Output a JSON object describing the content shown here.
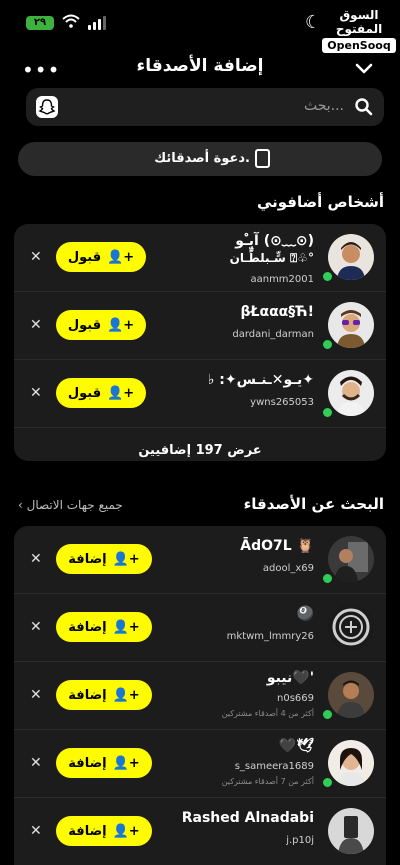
{
  "status": {
    "battery": "٢٩"
  },
  "brand": {
    "ar": "السوق المفتوح",
    "en": "OpenSooq"
  },
  "header": {
    "title": "إضافة الأصدقاء",
    "more": "•••"
  },
  "search": {
    "placeholder": "بحث..."
  },
  "invite": {
    "label": "دعوة أصدقائك."
  },
  "added_me": {
    "title": "أشخاص أضافوني",
    "view_all": "عرض 197 إضافيين",
    "accept_label": "قبول",
    "items": [
      {
        "name_line1": "آبٍـْو (⊙﹏⊙)",
        "name_line2": "سٍّـبلطٍّـان ⍰♧°",
        "username": "aanmm2001"
      },
      {
        "name_line1": "βŁααα§Ћ!",
        "username": "dardani_darman"
      },
      {
        "name_line1": "♭ :✦يـو✕ـنـس✦",
        "username": "ywns265053"
      }
    ]
  },
  "find_friends": {
    "title": "البحث عن الأصدقاء",
    "all_contacts": "جميع جهات الاتصال",
    "add_label": "إضافة",
    "items": [
      {
        "name": "ĀdO7L 🦉",
        "username": "adool_x69"
      },
      {
        "name": "🎱",
        "username": "mktwm_lmmry26"
      },
      {
        "name": "نيبو🖤'",
        "username": "n0s669",
        "mutual": "أكثر من 4 أصدقاء مشتركين"
      },
      {
        "name": "🖤🕊",
        "username": "s_sameera1689",
        "mutual": "أكثر من 7 أصدقاء مشتركين"
      },
      {
        "name": "Rashed Alnadabi",
        "username": "j.p10j"
      }
    ]
  },
  "colors": {
    "accent": "#fffc00",
    "background": "#000000",
    "card": "#1c1c1c",
    "online": "#2fcf57"
  }
}
